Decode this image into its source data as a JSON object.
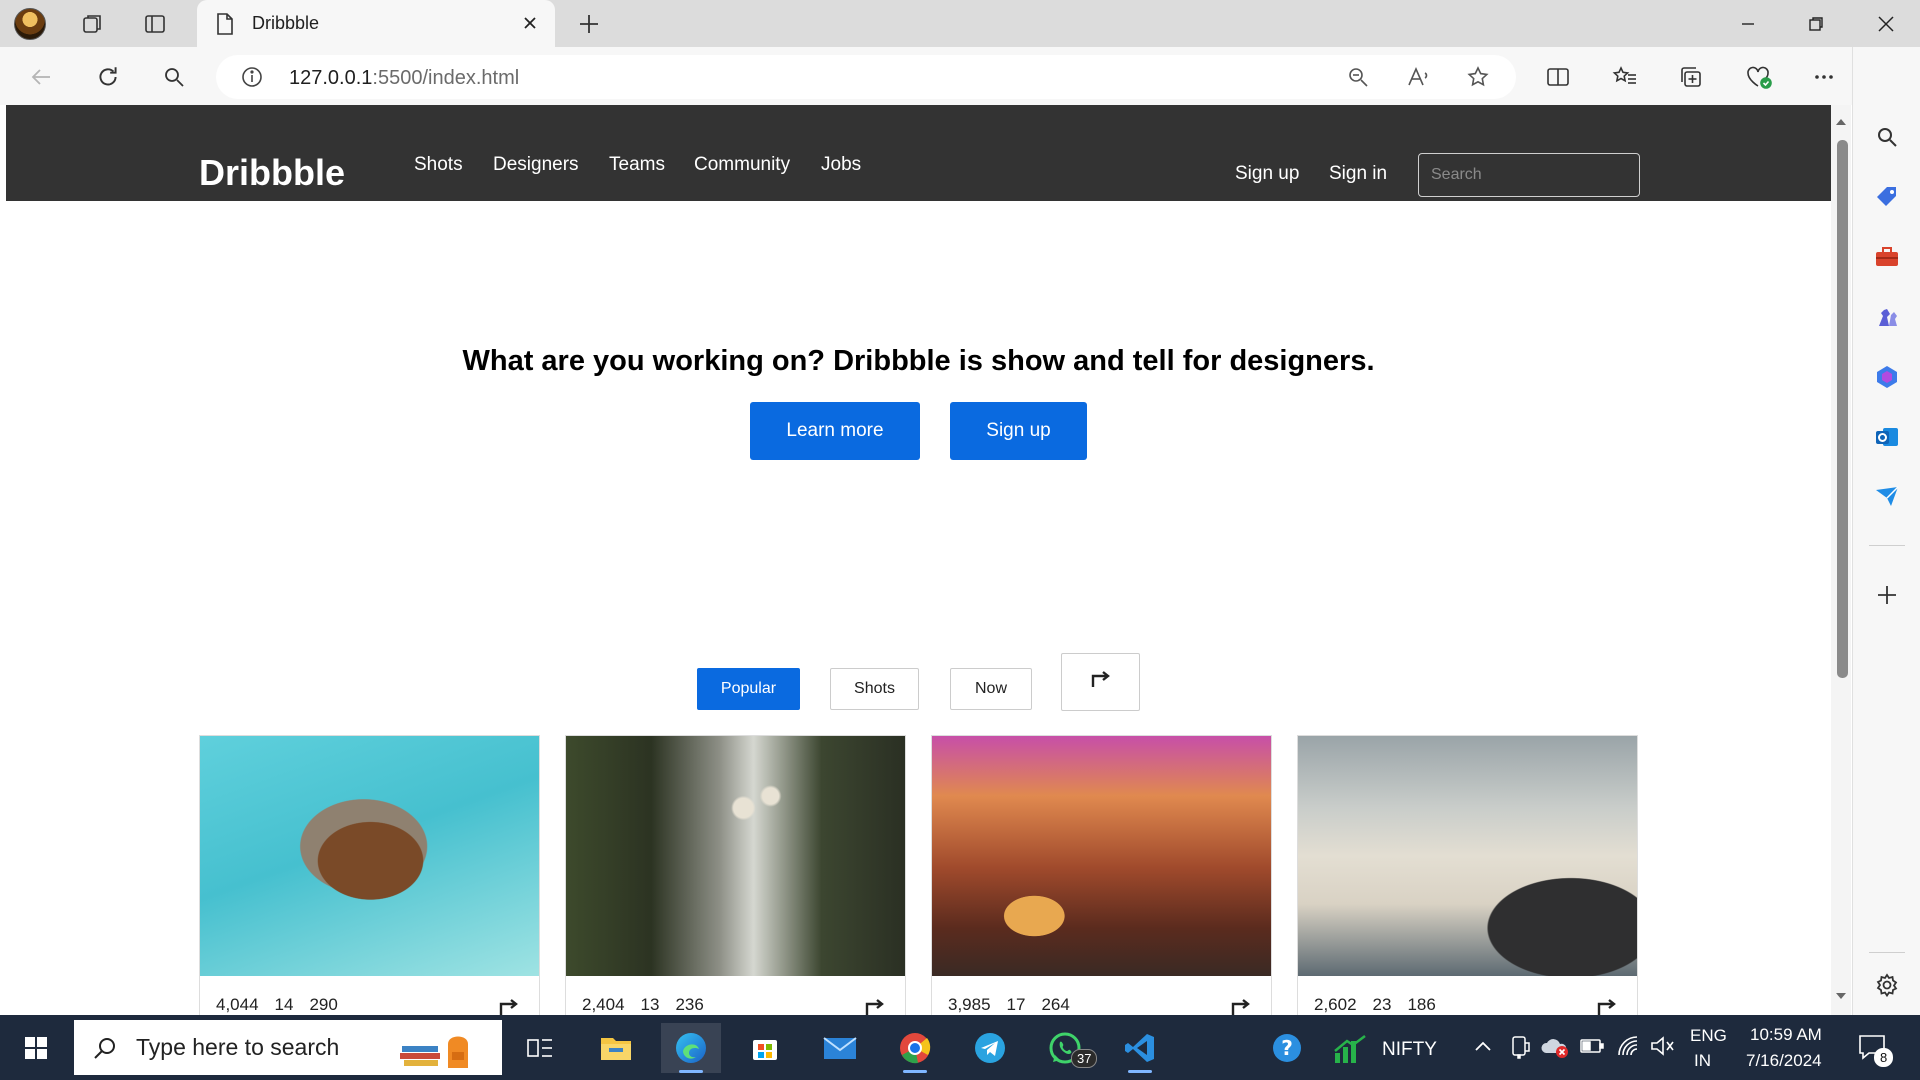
{
  "browser": {
    "tab_title": "Dribbble",
    "url_host": "127.0.0.1",
    "url_rest": ":5500/index.html"
  },
  "site": {
    "logo": "Dribbble",
    "nav": [
      "Shots",
      "Designers",
      "Teams",
      "Community",
      "Jobs"
    ],
    "sign_up": "Sign up",
    "sign_in": "Sign in",
    "search_placeholder": "Search"
  },
  "hero": {
    "title": "What are you working on? Dribbble is show and tell for designers.",
    "learn_more": "Learn more",
    "sign_up": "Sign up"
  },
  "filters": {
    "popular": "Popular",
    "shots": "Shots",
    "now": "Now"
  },
  "cards": [
    {
      "views": "4,044",
      "comments": "14",
      "likes": "290"
    },
    {
      "views": "2,404",
      "comments": "13",
      "likes": "236"
    },
    {
      "views": "3,985",
      "comments": "17",
      "likes": "264"
    },
    {
      "views": "2,602",
      "comments": "23",
      "likes": "186"
    }
  ],
  "taskbar": {
    "search_placeholder": "Type here to search",
    "whatsapp_badge": "37",
    "nifty": "NIFTY",
    "lang1": "ENG",
    "lang2": "IN",
    "time": "10:59 AM",
    "date": "7/16/2024",
    "notif_badge": "8"
  },
  "colors": {
    "header_bg": "#333333",
    "accent": "#0a6ae0",
    "taskbar_bg": "#1e2a3d"
  }
}
